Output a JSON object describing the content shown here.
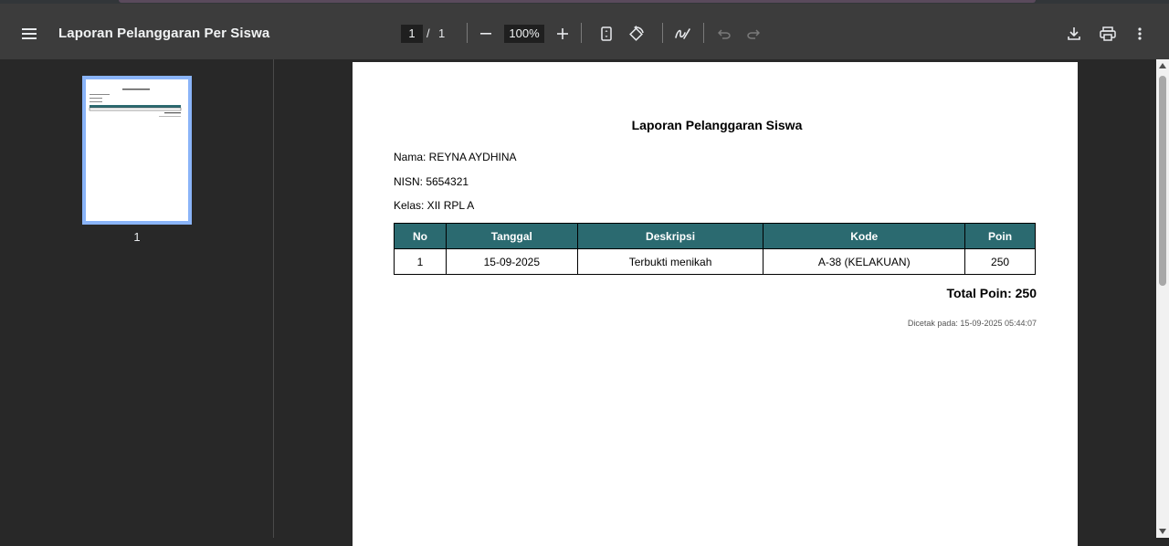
{
  "toolbar": {
    "doc_title": "Laporan Pelanggaran Per Siswa",
    "current_page": "1",
    "page_separator": "/",
    "total_pages": "1",
    "zoom": "100%"
  },
  "sidebar": {
    "thumbnails": [
      {
        "label": "1",
        "selected": true
      }
    ]
  },
  "report": {
    "title": "Laporan Pelanggaran Siswa",
    "nama": "Nama: REYNA AYDHINA",
    "nisn": "NISN: 5654321",
    "kelas": "Kelas: XII RPL A",
    "columns": [
      "No",
      "Tanggal",
      "Deskripsi",
      "Kode",
      "Poin"
    ],
    "rows": [
      [
        "1",
        "15-09-2025",
        "Terbukti menikah",
        "A-38 (KELAKUAN)",
        "250"
      ]
    ],
    "total": "Total Poin: 250",
    "printed": "Dicetak pada: 15-09-2025 05:44:07"
  },
  "colors": {
    "table_header": "#2b6a70",
    "toolbar": "#3c3c3c",
    "background": "#282828",
    "thumb_border": "#8ab4f8"
  },
  "icons": [
    "menu-icon",
    "zoom-out-icon",
    "zoom-in-icon",
    "fit-page-icon",
    "rotate-icon",
    "annotate-icon",
    "undo-icon",
    "redo-icon",
    "download-icon",
    "print-icon",
    "more-icon"
  ]
}
